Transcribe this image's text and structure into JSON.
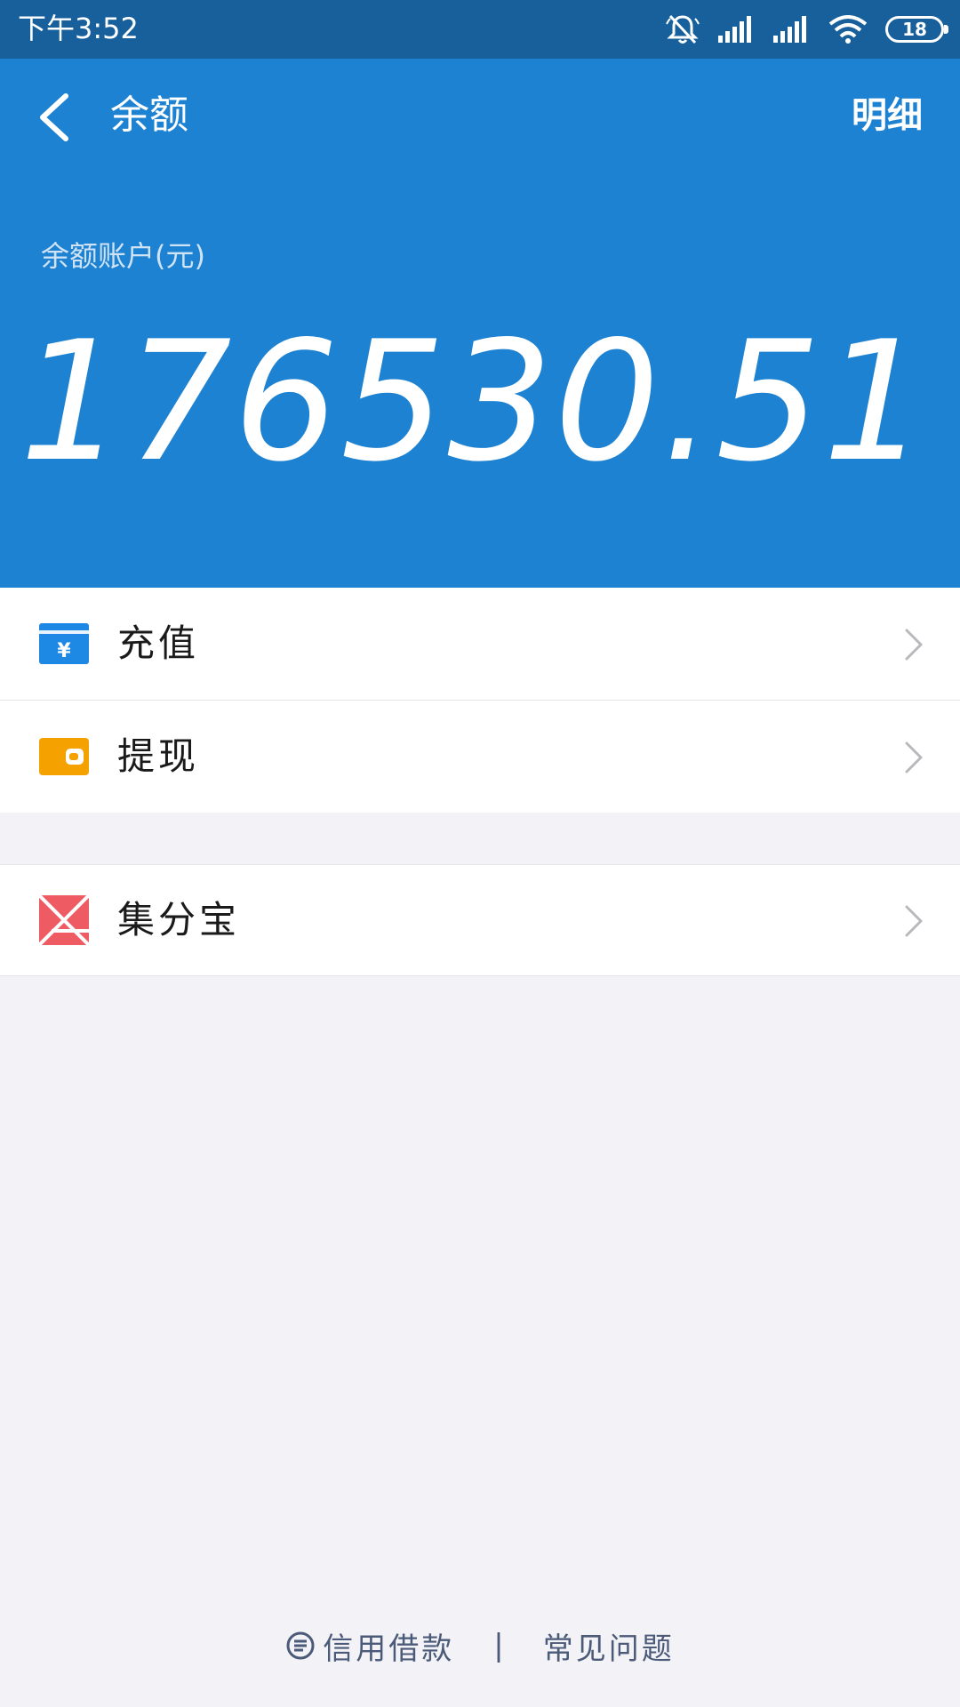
{
  "status_bar": {
    "time": "下午3:52",
    "battery": "18",
    "icons": [
      "mute-bell-icon",
      "signal-icon",
      "signal-icon",
      "wifi-icon",
      "battery-icon"
    ]
  },
  "header": {
    "title": "余额",
    "detail_label": "明细",
    "back_icon": "back-arrow-icon"
  },
  "balance": {
    "label": "余额账户(元)",
    "amount": "176530.51"
  },
  "menu": {
    "items": [
      {
        "label": "充值",
        "icon": "recharge-card-icon",
        "color": "#1e88e5"
      },
      {
        "label": "提现",
        "icon": "wallet-icon",
        "color": "#f5a100"
      },
      {
        "label": "集分宝",
        "icon": "jifenbao-icon",
        "color": "#ef5b63"
      }
    ]
  },
  "footer": {
    "credit_loan": "信用借款",
    "separator": "|",
    "faq": "常见问题"
  },
  "colors": {
    "status_bar": "#17609b",
    "header": "#1e82d2",
    "background": "#f3f3f7"
  }
}
